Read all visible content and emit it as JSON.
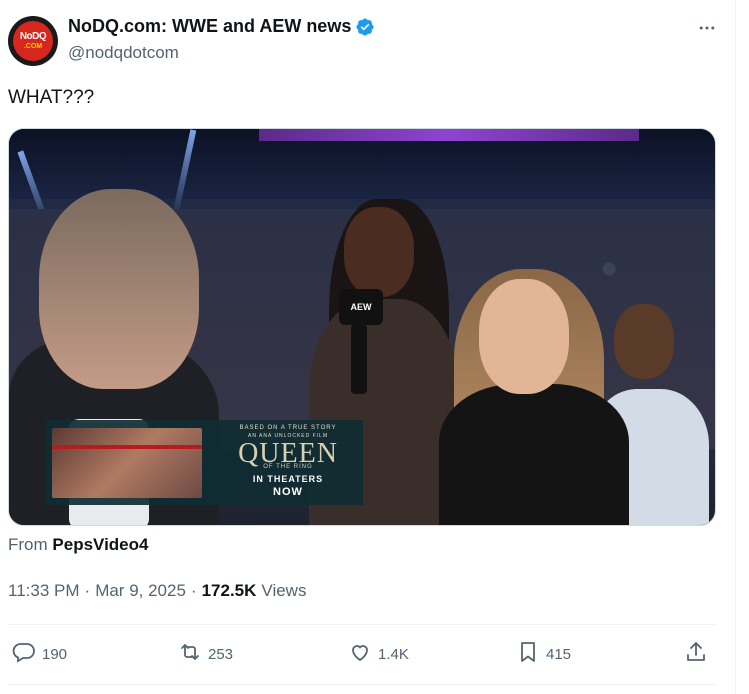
{
  "author": {
    "display_name": "NoDQ.com: WWE and AEW news",
    "handle": "@nodqdotcom",
    "avatar_text_top": "NoDQ",
    "avatar_text_bottom": ".COM",
    "verified": true
  },
  "tweet": {
    "text": "WHAT???"
  },
  "media": {
    "mic_flag": "AEW",
    "ad": {
      "tagline": "BASED ON A TRUE STORY",
      "subline": "AN ANA UNLOCKED FILM",
      "title": "QUEEN",
      "title_sub": "OF THE RING",
      "cta1": "IN THEATERS",
      "cta2": "NOW"
    }
  },
  "source": {
    "prefix": "From",
    "name": "PepsVideo4"
  },
  "meta": {
    "time": "11:33 PM",
    "sep1": "·",
    "date": "Mar 9, 2025",
    "sep2": "·",
    "views_count": "172.5K",
    "views_label": "Views"
  },
  "actions": {
    "replies": "190",
    "reposts": "253",
    "likes": "1.4K",
    "bookmarks": "415"
  },
  "colors": {
    "verified_blue": "#1d9bf0",
    "text_primary": "#0f1419",
    "text_secondary": "#536471"
  },
  "icons": [
    "more-icon",
    "verified-icon",
    "reply-icon",
    "repost-icon",
    "like-icon",
    "bookmark-icon",
    "share-icon"
  ]
}
